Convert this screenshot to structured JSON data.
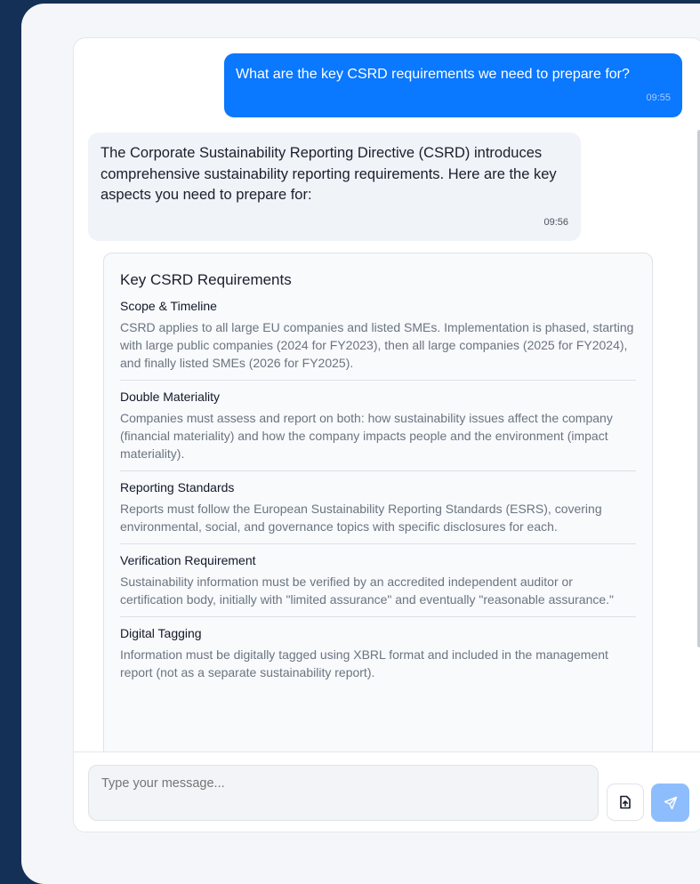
{
  "conversation": {
    "user_message": {
      "text": "What are the key CSRD requirements we need to prepare for?",
      "time": "09:55"
    },
    "assistant_message": {
      "text": "The Corporate Sustainability Reporting Directive (CSRD) introduces comprehensive sustainability reporting requirements. Here are the key aspects you need to prepare for:",
      "time": "09:56"
    },
    "requirements_card": {
      "title": "Key CSRD Requirements",
      "sections": [
        {
          "heading": "Scope & Timeline",
          "body": "CSRD applies to all large EU companies and listed SMEs. Implementation is phased, starting with large public companies (2024 for FY2023), then all large companies (2025 for FY2024), and finally listed SMEs (2026 for FY2025)."
        },
        {
          "heading": "Double Materiality",
          "body": "Companies must assess and report on both: how sustainability issues affect the company (financial materiality) and how the company impacts people and the environment (impact materiality)."
        },
        {
          "heading": "Reporting Standards",
          "body": "Reports must follow the European Sustainability Reporting Standards (ESRS), covering environmental, social, and governance topics with specific disclosures for each."
        },
        {
          "heading": "Verification Requirement",
          "body": "Sustainability information must be verified by an accredited independent auditor or certification body, initially with \"limited assurance\" and eventually \"reasonable assurance.\""
        },
        {
          "heading": "Digital Tagging",
          "body": "Information must be digitally tagged using XBRL format and included in the management report (not as a separate sustainability report)."
        }
      ]
    }
  },
  "composer": {
    "placeholder": "Type your message...",
    "attach_icon": "file-upload-icon",
    "send_icon": "send-icon"
  },
  "colors": {
    "background": "#153056",
    "user_bubble": "#0a78ff",
    "send_button": "#8dbdfd"
  }
}
